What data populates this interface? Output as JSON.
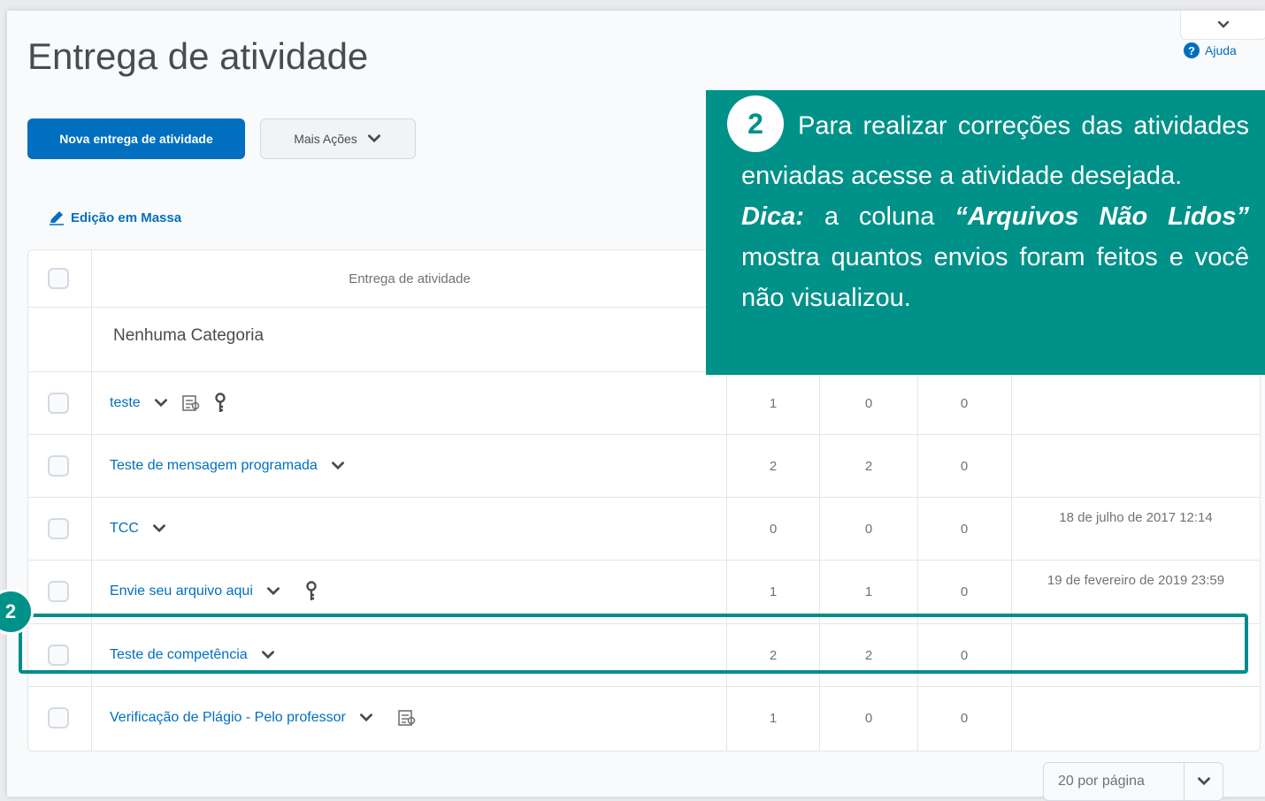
{
  "header": {
    "title": "Entrega de atividade",
    "help_label": "Ajuda"
  },
  "toolbar": {
    "new_label": "Nova entrega de atividade",
    "more_label": "Mais Ações",
    "mass_edit_label": "Edição em Massa"
  },
  "table": {
    "column_header": "Entrega de atividade",
    "category": "Nenhuma Categoria",
    "rows": [
      {
        "name": "teste",
        "c1": "1",
        "c2": "0",
        "c3": "0",
        "due": ""
      },
      {
        "name": "Teste de mensagem programada",
        "c1": "2",
        "c2": "2",
        "c3": "0",
        "due": ""
      },
      {
        "name": "TCC",
        "c1": "0",
        "c2": "0",
        "c3": "0",
        "due": "18 de julho de 2017 12:14"
      },
      {
        "name": "Envie seu arquivo aqui",
        "c1": "1",
        "c2": "1",
        "c3": "0",
        "due": "19 de fevereiro de 2019 23:59"
      },
      {
        "name": "Teste de competência",
        "c1": "2",
        "c2": "2",
        "c3": "0",
        "due": ""
      },
      {
        "name": "Verificação de Plágio - Pelo professor",
        "c1": "1",
        "c2": "0",
        "c3": "0",
        "due": ""
      }
    ]
  },
  "callout": {
    "badge": "2",
    "line1": "Para realizar correções das atividades enviadas acesse a atividade desejada.",
    "tip_label": "Dica:",
    "tip_mid": " a coluna ",
    "tip_col": "“Arquivos Não Lidos”",
    "tip_end": " mostra quantos envios foram feitos e você não visualizou."
  },
  "marker_badge": "2",
  "pager": {
    "label": "20 por página"
  },
  "colors": {
    "primary": "#006fbf",
    "accent": "#009189"
  }
}
